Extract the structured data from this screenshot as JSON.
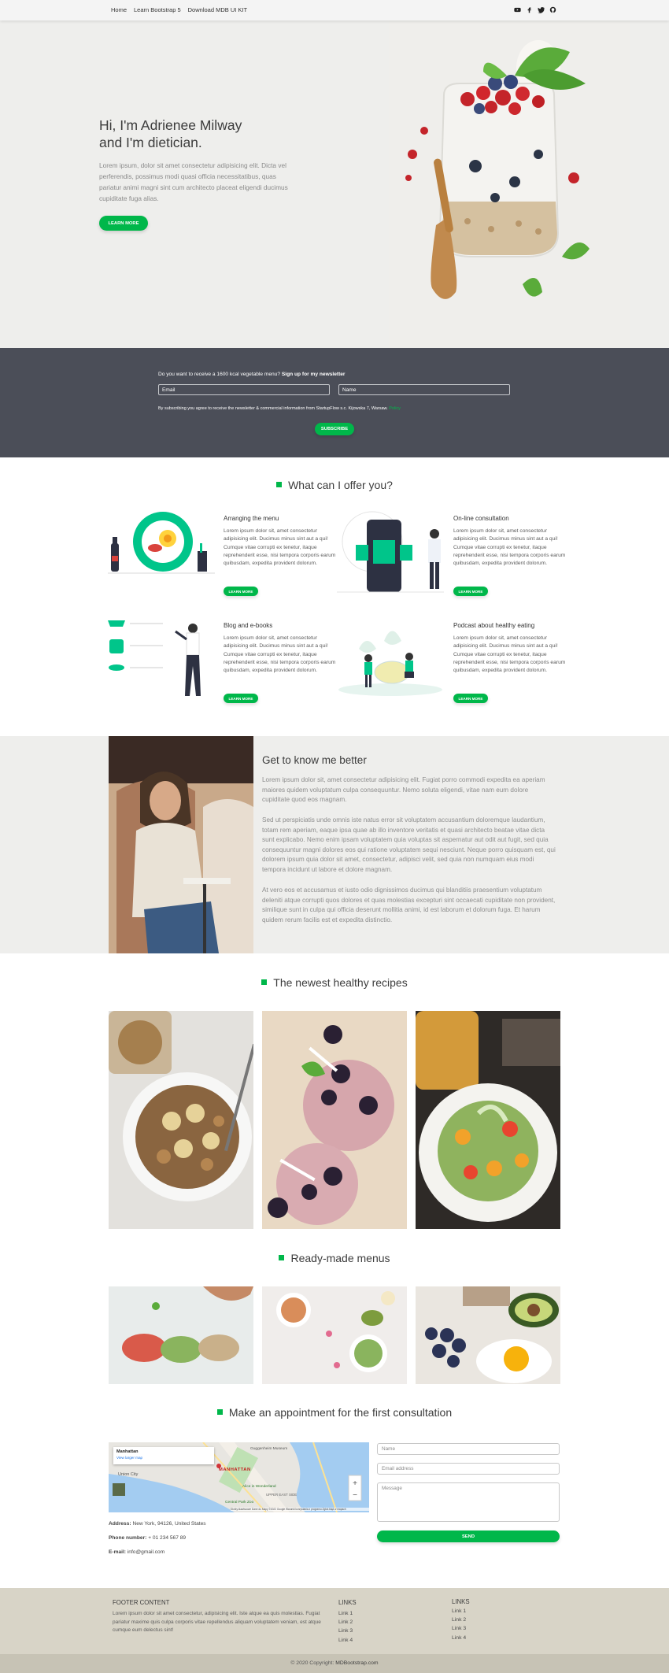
{
  "navbar": {
    "links": [
      "Home",
      "Learn Bootstrap 5",
      "Download MDB UI KIT"
    ],
    "icons": [
      "youtube-icon",
      "facebook-icon",
      "twitter-icon",
      "github-icon"
    ]
  },
  "hero": {
    "title_line1": "Hi, I'm Adrienee Milway",
    "title_line2": "and I'm dietician.",
    "text": "Lorem ipsum, dolor sit amet consectetur adipisicing elit. Dicta vel perferendis, possimus modi quasi officia necessitatibus, quas pariatur animi magni sint cum architecto placeat eligendi ducimus cupiditate fuga alias.",
    "button": "LEARN MORE"
  },
  "newsletter": {
    "question": "Do you want to receive a 1600 kcal vegetable menu? ",
    "question_bold": "Sign up for my newsletter",
    "email_placeholder": "Email",
    "name_placeholder": "Name",
    "note": "By subscribing you agree to receive the newsletter & commercial information from StartupFlow s.c. Kijowska 7, Warsaw.",
    "note_link": "Policy",
    "button": "SUBSCRIBE"
  },
  "offer": {
    "title": "What can I offer you?",
    "items": [
      {
        "title": "Arranging the menu",
        "text": "Lorem ipsum dolor sit, amet consectetur adipisicing elit. Ducimus minus sint aut a qui! Cumque vitae corrupti ex tenetur, itaque reprehenderit esse, nisi tempora corporis earum quibusdam, expedita provident dolorum.",
        "button": "LEARN MORE"
      },
      {
        "title": "On-line consultation",
        "text": "Lorem ipsum dolor sit, amet consectetur adipisicing elit. Ducimus minus sint aut a qui! Cumque vitae corrupti ex tenetur, itaque reprehenderit esse, nisi tempora corporis earum quibusdam, expedita provident dolorum.",
        "button": "LEARN MORE"
      },
      {
        "title": "Blog and e-books",
        "text": "Lorem ipsum dolor sit, amet consectetur adipisicing elit. Ducimus minus sint aut a qui! Cumque vitae corrupti ex tenetur, itaque reprehenderit esse, nisi tempora corporis earum quibusdam, expedita provident dolorum.",
        "button": "LEARN MORE"
      },
      {
        "title": "Podcast about healthy eating",
        "text": "Lorem ipsum dolor sit, amet consectetur adipisicing elit. Ducimus minus sint aut a qui! Cumque vitae corrupti ex tenetur, itaque reprehenderit esse, nisi tempora corporis earum quibusdam, expedita provident dolorum.",
        "button": "LEARN MORE"
      }
    ]
  },
  "about": {
    "title": "Get to know me better",
    "p1": "Lorem ipsum dolor sit, amet consectetur adipisicing elit. Fugiat porro commodi expedita ea aperiam maiores quidem voluptatum culpa consequuntur. Nemo soluta eligendi, vitae nam eum dolore cupiditate quod eos magnam.",
    "p2": "Sed ut perspiciatis unde omnis iste natus error sit voluptatem accusantium doloremque laudantium, totam rem aperiam, eaque ipsa quae ab illo inventore veritatis et quasi architecto beatae vitae dicta sunt explicabo. Nemo enim ipsam voluptatem quia voluptas sit aspernatur aut odit aut fugit, sed quia consequuntur magni dolores eos qui ratione voluptatem sequi nesciunt. Neque porro quisquam est, qui dolorem ipsum quia dolor sit amet, consectetur, adipisci velit, sed quia non numquam eius modi tempora incidunt ut labore et dolore magnam.",
    "p3": "At vero eos et accusamus et iusto odio dignissimos ducimus qui blanditiis praesentium voluptatum deleniti atque corrupti quos dolores et quas molestias excepturi sint occaecati cupiditate non provident, similique sunt in culpa qui officia deserunt mollitia animi, id est laborum et dolorum fuga. Et harum quidem rerum facilis est et expedita distinctio."
  },
  "recipes": {
    "title": "The newest healthy recipes"
  },
  "menus": {
    "title": "Ready-made menus"
  },
  "appointment": {
    "title": "Make an appointment for the first consultation",
    "map": {
      "place": "Manhattan",
      "link": "View larger map",
      "labels": [
        "MANHATTAN",
        "Union City",
        "Alice in Wonderland",
        "Central Park Zoo",
        "Guggenheim Museum",
        "UPPER EAST SIDE"
      ],
      "footer": "Skróty klawiszowe   Dane do Mapy ©2022 Google   Warunki korzystania z programu   Zgłoś błąd w mapach"
    },
    "address_label": "Address:",
    "address": "New York, 94126, United States",
    "phone_label": "Phone number:",
    "phone": "+ 01 234 567 89",
    "email_label": "E-mail:",
    "email": "info@gmail.com",
    "form": {
      "name_placeholder": "Name",
      "email_placeholder": "Email address",
      "message_placeholder": "Message",
      "button": "SEND"
    }
  },
  "footer": {
    "content_title": "FOOTER CONTENT",
    "content_text": "Lorem ipsum dolor sit amet consectetur, adipisicing elit. Iste atque ea quis molestias. Fugiat pariatur maxime quis culpa corporis vitae repellendus aliquam voluptatem veniam, est atque cumque eum delectus sint!",
    "links1_title": "LINKS",
    "links1": [
      "Link 1",
      "Link 2",
      "Link 3",
      "Link 4"
    ],
    "links2_title": "LINKS",
    "links2": [
      "Link 1",
      "Link 2",
      "Link 3",
      "Link 4"
    ],
    "copyright": "© 2020 Copyright: ",
    "copyright_brand": "MDBootstrap.com"
  },
  "colors": {
    "accent": "#00b74a",
    "newsletter_bg": "#4b4e58",
    "footer_bg": "#d8d4c7",
    "hero_bg": "#eeeeec"
  }
}
